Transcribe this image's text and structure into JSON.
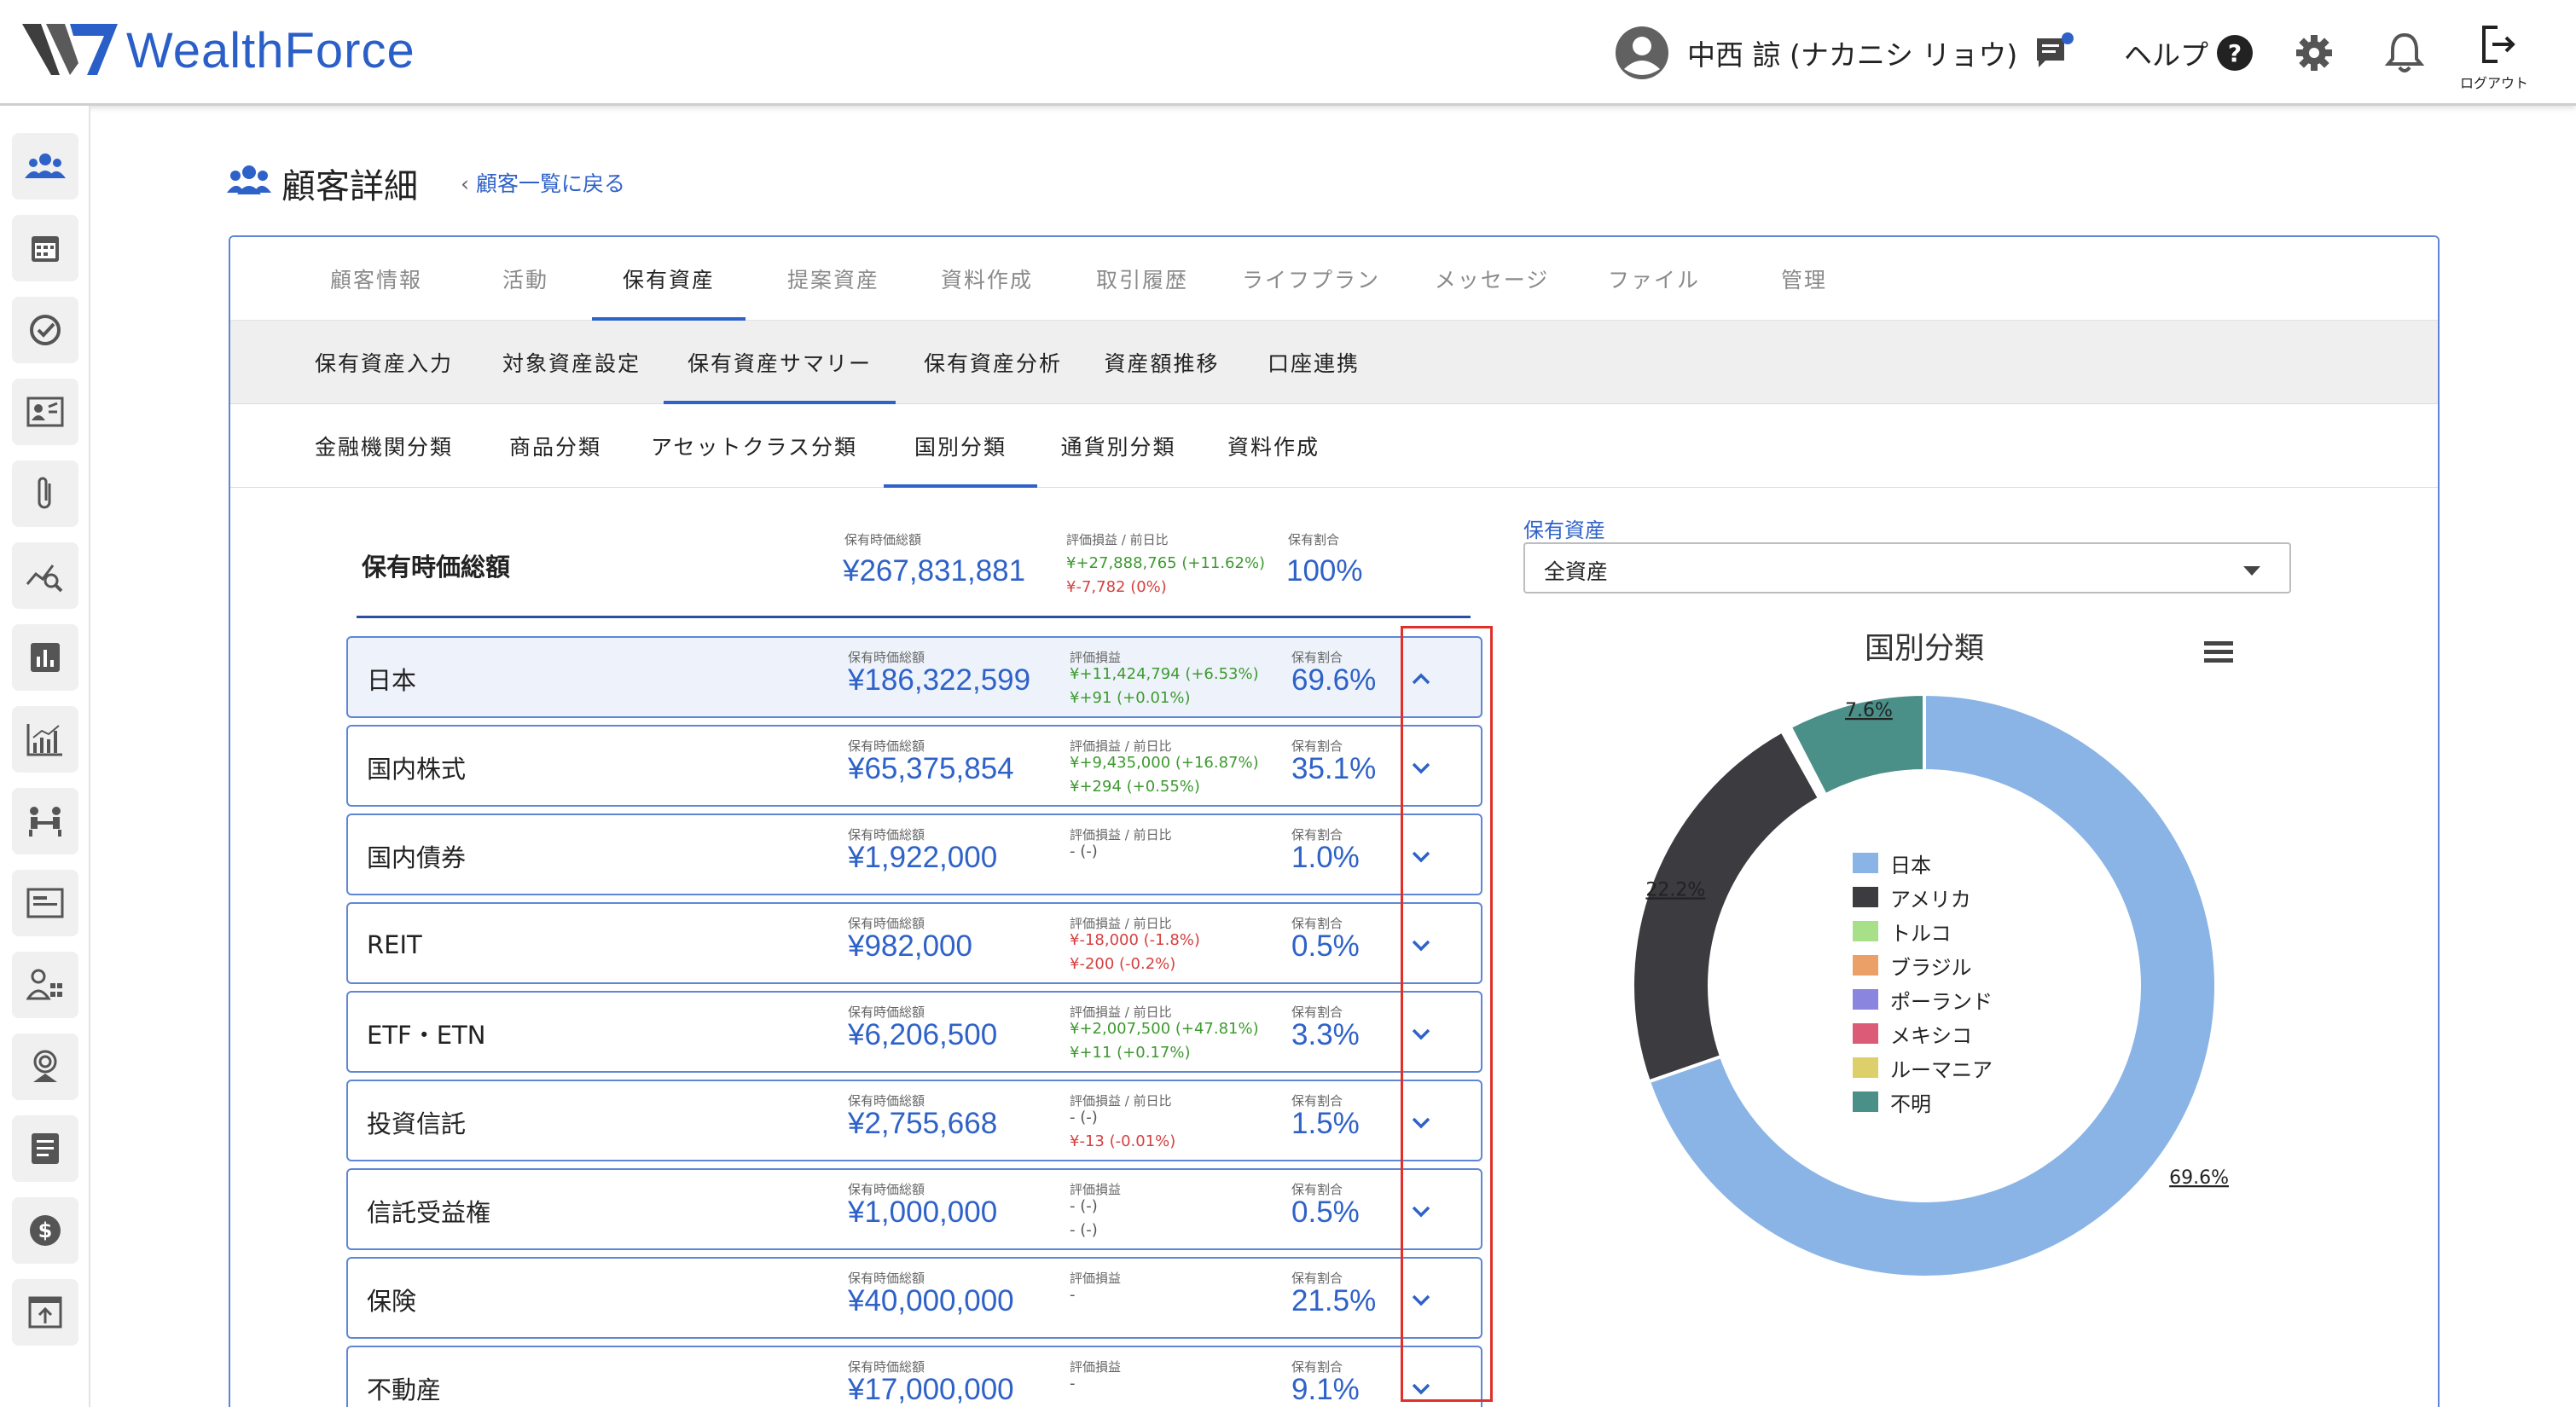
{
  "header": {
    "brand": "WealthForce",
    "user_name": "中西 諒 (ナカニシ リョウ)",
    "help_label": "ヘルプ",
    "logout_label": "ログアウト"
  },
  "sidebar": {
    "items": [
      "customers-icon",
      "calendar-icon",
      "check-icon",
      "profile-card-icon",
      "attachment-icon",
      "analysis-icon",
      "report-chart-icon",
      "bar-chart-icon",
      "meeting-icon",
      "document-icon",
      "user-admin-icon",
      "ring-icon",
      "notes-icon",
      "dollar-icon",
      "export-icon"
    ]
  },
  "page": {
    "title": "顧客詳細",
    "back_link": "顧客一覧に戻る"
  },
  "tabs_level1": [
    "顧客情報",
    "活動",
    "保有資産",
    "提案資産",
    "資料作成",
    "取引履歴",
    "ライフプラン",
    "メッセージ",
    "ファイル",
    "管理"
  ],
  "tabs_level2": [
    "保有資産入力",
    "対象資産設定",
    "保有資産サマリー",
    "保有資産分析",
    "資産額推移",
    "口座連携"
  ],
  "tabs_level3": [
    "金融機関分類",
    "商品分類",
    "アセットクラス分類",
    "国別分類",
    "通貨別分類",
    "資料作成"
  ],
  "summary": {
    "title": "保有時価総額",
    "cap_value": "保有時価総額",
    "value": "¥267,831,881",
    "cap_gain": "評価損益 / 前日比",
    "gain1": "¥+27,888,765 (+11.62%)",
    "gain2": "¥-7,782 (0%)",
    "cap_ratio": "保有割合",
    "ratio": "100%"
  },
  "rows": [
    {
      "label": "日本",
      "cap_value": "保有時価総額",
      "value": "¥186,322,599",
      "cap_gain": "評価損益",
      "gain1": "¥+11,424,794 (+6.53%)",
      "gain2": "¥+91 (+0.01%)",
      "cap_ratio": "保有割合",
      "ratio": "69.6%"
    },
    {
      "label": "国内株式",
      "cap_value": "保有時価総額",
      "value": "¥65,375,854",
      "cap_gain": "評価損益 / 前日比",
      "gain1": "¥+9,435,000 (+16.87%)",
      "gain2": "¥+294 (+0.55%)",
      "cap_ratio": "保有割合",
      "ratio": "35.1%"
    },
    {
      "label": "国内債券",
      "cap_value": "保有時価総額",
      "value": "¥1,922,000",
      "cap_gain": "評価損益 / 前日比",
      "gain1": "- (-)",
      "gain2": "",
      "cap_ratio": "保有割合",
      "ratio": "1.0%"
    },
    {
      "label": "REIT",
      "cap_value": "保有時価総額",
      "value": "¥982,000",
      "cap_gain": "評価損益 / 前日比",
      "gain1": "¥-18,000 (-1.8%)",
      "gain2": "¥-200 (-0.2%)",
      "cap_ratio": "保有割合",
      "ratio": "0.5%"
    },
    {
      "label": "ETF・ETN",
      "cap_value": "保有時価総額",
      "value": "¥6,206,500",
      "cap_gain": "評価損益 / 前日比",
      "gain1": "¥+2,007,500 (+47.81%)",
      "gain2": "¥+11 (+0.17%)",
      "cap_ratio": "保有割合",
      "ratio": "3.3%"
    },
    {
      "label": "投資信託",
      "cap_value": "保有時価総額",
      "value": "¥2,755,668",
      "cap_gain": "評価損益 / 前日比",
      "gain1": "- (-)",
      "gain2": "¥-13 (-0.01%)",
      "cap_ratio": "保有割合",
      "ratio": "1.5%"
    },
    {
      "label": "信託受益権",
      "cap_value": "保有時価総額",
      "value": "¥1,000,000",
      "cap_gain": "評価損益",
      "gain1": "- (-)",
      "gain2": "- (-)",
      "cap_ratio": "保有割合",
      "ratio": "0.5%"
    },
    {
      "label": "保険",
      "cap_value": "保有時価総額",
      "value": "¥40,000,000",
      "cap_gain": "評価損益",
      "gain1": "-",
      "gain2": "",
      "cap_ratio": "保有割合",
      "ratio": "21.5%"
    },
    {
      "label": "不動産",
      "cap_value": "保有時価総額",
      "value": "¥17,000,000",
      "cap_gain": "評価損益",
      "gain1": "-",
      "gain2": "",
      "cap_ratio": "保有割合",
      "ratio": "9.1%"
    }
  ],
  "select": {
    "label": "保有資産",
    "value": "全資産"
  },
  "chart_data": {
    "type": "pie",
    "title": "国別分類",
    "categories": [
      "日本",
      "アメリカ",
      "トルコ",
      "ブラジル",
      "ポーランド",
      "メキシコ",
      "ルーマニア",
      "不明"
    ],
    "values": [
      69.6,
      22.2,
      0.1,
      0.1,
      0.1,
      0.1,
      0.1,
      7.6
    ],
    "colors": [
      "#8ab4e6",
      "#3b3b40",
      "#a8e08a",
      "#eba068",
      "#8a85de",
      "#dc5c78",
      "#ddd06a",
      "#4a8f88"
    ],
    "data_labels": [
      "69.6%",
      "22.2%",
      "7.6%"
    ],
    "legend_position": "center"
  },
  "colors": {
    "accent": "#2f62c8",
    "positive": "#3d9a2f",
    "negative": "#d64040",
    "highlight_box": "#e0302a"
  }
}
